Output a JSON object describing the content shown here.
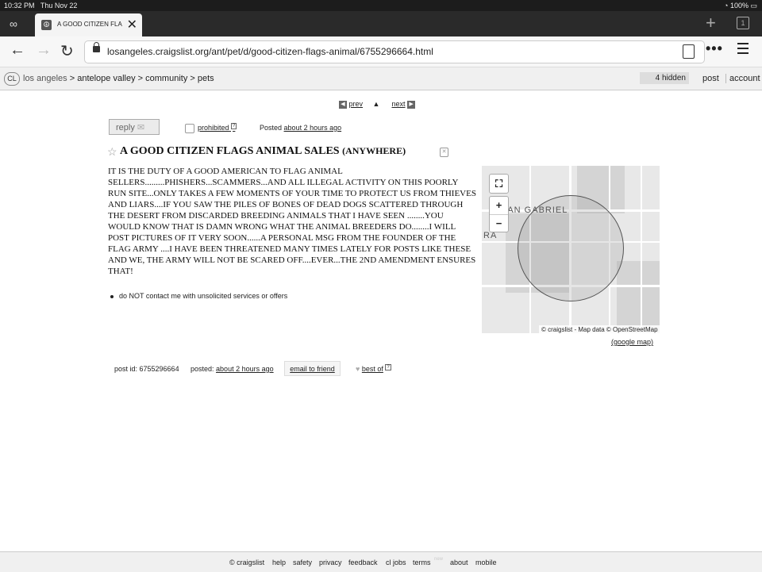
{
  "status": {
    "time": "10:32 PM",
    "date": "Thu Nov 22",
    "battery": "100%"
  },
  "browser": {
    "tab_title": "A GOOD CITIZEN FLAGS ANIMAL SALES",
    "tab_count": "1",
    "url": "losangeles.craigslist.org/ant/pet/d/good-citizen-flags-animal/6755296664.html",
    "icons": [
      "mask-icon",
      "back-icon",
      "forward-icon",
      "reload-icon",
      "lock-icon",
      "reader-icon",
      "more-icon",
      "menu-icon",
      "plus-icon",
      "tabs-icon"
    ]
  },
  "cl": {
    "logo": "CL",
    "location": "los angeles",
    "crumb1": "antelope valley",
    "crumb2": "community",
    "crumb3": "pets",
    "hidden": "4 hidden",
    "post": "post",
    "account": "account"
  },
  "pager": {
    "prev": "prev",
    "next": "next"
  },
  "actions": {
    "reply": "reply",
    "prohibited": "prohibited",
    "help_mark": "?",
    "posted_prefix": "Posted",
    "posted_time": "about 2 hours ago"
  },
  "listing": {
    "title": "A GOOD CITIZEN FLAGS ANIMAL SALES",
    "area": "(ANYWHERE)",
    "body": "IT IS THE DUTY OF A GOOD AMERICAN TO FLAG ANIMAL SELLERS.........PHISHERS...SCAMMERS...AND ALL ILLEGAL ACTIVITY ON THIS POORLY RUN SITE...ONLY TAKES A FEW MOMENTS OF YOUR TIME TO PROTECT US FROM THIEVES AND LIARS....IF YOU SAW THE PILES OF BONES OF DEAD DOGS SCATTERED THROUGH THE DESERT FROM DISCARDED BREEDING ANIMALS THAT I HAVE SEEN ........YOU WOULD KNOW THAT IS DAMN WRONG WHAT THE ANIMAL BREEDERS DO........I WILL POST PICTURES OF IT VERY SOON......A PERSONAL MSG FROM THE FOUNDER OF THE FLAG ARMY ....I HAVE BEEN THREATENED MANY TIMES LATELY FOR POSTS LIKE THESE AND WE, THE ARMY WILL NOT BE SCARED OFF....EVER...THE 2ND AMENDMENT ENSURES THAT!",
    "notice": "do NOT contact me with unsolicited services or offers"
  },
  "map": {
    "label1": "SAN GABRIEL",
    "label2": "RA",
    "zoom_in": "+",
    "zoom_out": "−",
    "attribution": "© craigslist - Map data © OpenStreetMap",
    "google_link": "(google map)"
  },
  "postinfo": {
    "id_text": "post id: 6755296664",
    "posted_prefix": "posted:",
    "posted_time": "about 2 hours ago",
    "email": "email to friend",
    "best_of": "best of",
    "help_mark": "?"
  },
  "footer": {
    "items": [
      "© craigslist",
      "help",
      "safety",
      "privacy",
      "feedback",
      "cl jobs",
      "terms",
      "new",
      "about",
      "mobile"
    ]
  }
}
